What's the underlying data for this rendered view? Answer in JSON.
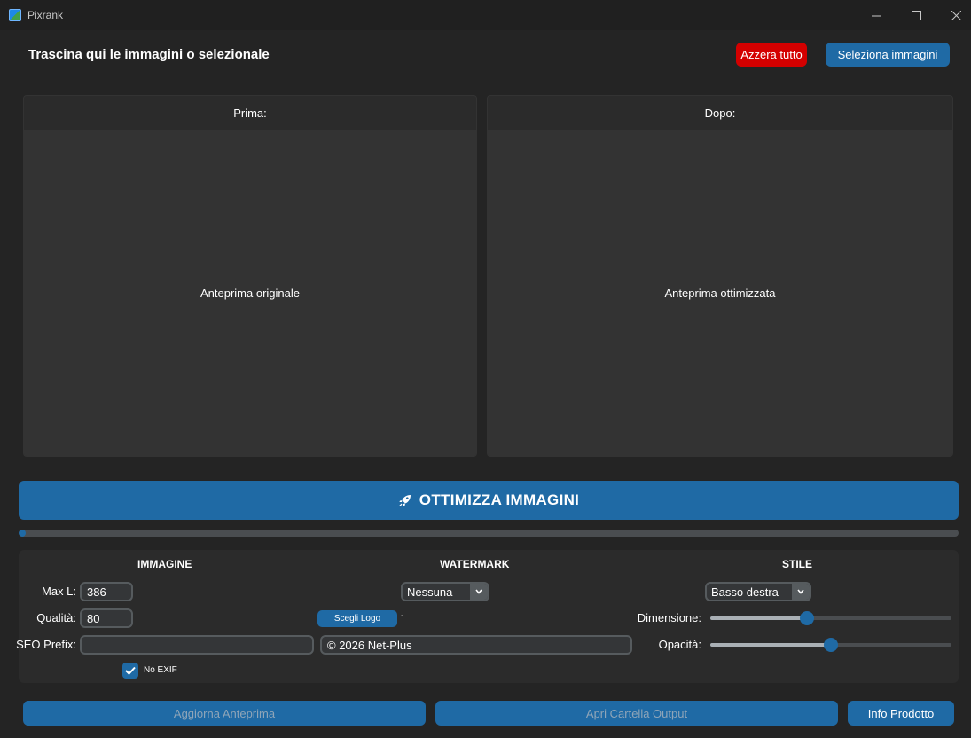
{
  "window": {
    "title": "Pixrank",
    "controls": {
      "minimize": "—",
      "maximize": "☐",
      "close": "✕"
    }
  },
  "header": {
    "drop_title": "Trascina qui le immagini o selezionale",
    "reset_label": "Azzera tutto",
    "select_label": "Seleziona immagini"
  },
  "preview": {
    "before_title": "Prima:",
    "before_placeholder": "Anteprima originale",
    "after_title": "Dopo:",
    "after_placeholder": "Anteprima ottimizzata"
  },
  "optimize": {
    "label": "OTTIMIZZA IMMAGINI",
    "icon": "rocket-icon",
    "progress": 0.008
  },
  "settings": {
    "image": {
      "title": "IMMAGINE",
      "max_width_label": "Max L:",
      "max_width_value": "386",
      "quality_label": "Qualità:",
      "quality_value": "80",
      "seo_prefix_label": "SEO Prefix:",
      "seo_prefix_value": "",
      "no_exif_label": "No EXIF",
      "no_exif_checked": true
    },
    "watermark": {
      "title": "WATERMARK",
      "type_value": "Nessuna",
      "logo_button_label": "Scegli Logo",
      "logo_path": "-",
      "text_value": "© 2026 Net-Plus"
    },
    "style": {
      "title": "STILE",
      "position_value": "Basso destra",
      "size_label": "Dimensione:",
      "size_value": 0.4,
      "opacity_label": "Opacità:",
      "opacity_value": 0.5
    }
  },
  "footer": {
    "refresh_label": "Aggiorna Anteprima",
    "open_output_label": "Apri Cartella Output",
    "info_label": "Info Prodotto"
  },
  "colors": {
    "accent": "#1f6aa5",
    "danger": "#d40000",
    "background": "#242424",
    "panel": "#2b2b2b"
  }
}
